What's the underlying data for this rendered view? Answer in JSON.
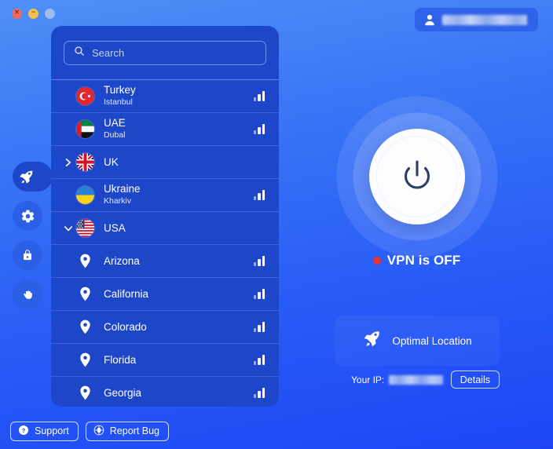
{
  "window": {
    "controls": [
      {
        "name": "close",
        "glyph": "×"
      },
      {
        "name": "minimize",
        "glyph": "−"
      },
      {
        "name": "zoom",
        "glyph": ""
      }
    ]
  },
  "account": {
    "icon": "person-icon",
    "username_redacted": true
  },
  "sidebar": {
    "items": [
      {
        "id": "rocket",
        "icon": "rocket-icon",
        "active": true
      },
      {
        "id": "settings",
        "icon": "gear-icon",
        "active": false
      },
      {
        "id": "security",
        "icon": "lock-icon",
        "active": false
      },
      {
        "id": "privacy",
        "icon": "hand-icon",
        "active": false
      }
    ]
  },
  "search": {
    "placeholder": "Search",
    "value": "",
    "icon": "search-icon"
  },
  "locations": [
    {
      "type": "country",
      "name": "Turkey",
      "city": "Istanbul",
      "flag": "tr",
      "expandable": false,
      "expanded": false,
      "signal": 3
    },
    {
      "type": "country",
      "name": "UAE",
      "city": "Dubal",
      "flag": "ae",
      "expandable": false,
      "expanded": false,
      "signal": 3
    },
    {
      "type": "country",
      "name": "UK",
      "city": "",
      "flag": "uk",
      "expandable": true,
      "expanded": false,
      "signal": 0
    },
    {
      "type": "country",
      "name": "Ukraine",
      "city": "Kharkiv",
      "flag": "ua",
      "expandable": false,
      "expanded": false,
      "signal": 3
    },
    {
      "type": "country",
      "name": "USA",
      "city": "",
      "flag": "us",
      "expandable": true,
      "expanded": true,
      "signal": 0
    },
    {
      "type": "state",
      "name": "Arizona",
      "city": "",
      "flag": "",
      "expandable": false,
      "expanded": false,
      "signal": 3
    },
    {
      "type": "state",
      "name": "California",
      "city": "",
      "flag": "",
      "expandable": false,
      "expanded": false,
      "signal": 3
    },
    {
      "type": "state",
      "name": "Colorado",
      "city": "",
      "flag": "",
      "expandable": false,
      "expanded": false,
      "signal": 3
    },
    {
      "type": "state",
      "name": "Florida",
      "city": "",
      "flag": "",
      "expandable": false,
      "expanded": false,
      "signal": 3
    },
    {
      "type": "state",
      "name": "Georgia",
      "city": "",
      "flag": "",
      "expandable": false,
      "expanded": false,
      "signal": 3
    }
  ],
  "power": {
    "icon": "power-icon",
    "state": "off"
  },
  "status": {
    "text": "VPN is OFF",
    "dot_color": "#e8352a"
  },
  "optimal": {
    "label": "Optimal Location",
    "icon": "rocket-icon"
  },
  "ip": {
    "label": "Your IP:",
    "value_redacted": true,
    "details_label": "Details"
  },
  "bottom": {
    "support_label": "Support",
    "support_icon": "question-circle-icon",
    "report_label": "Report Bug",
    "report_icon": "bug-icon"
  },
  "colors": {
    "panel": "#1e46c8",
    "accent": "#2b5fe6",
    "status_off": "#e8352a"
  }
}
